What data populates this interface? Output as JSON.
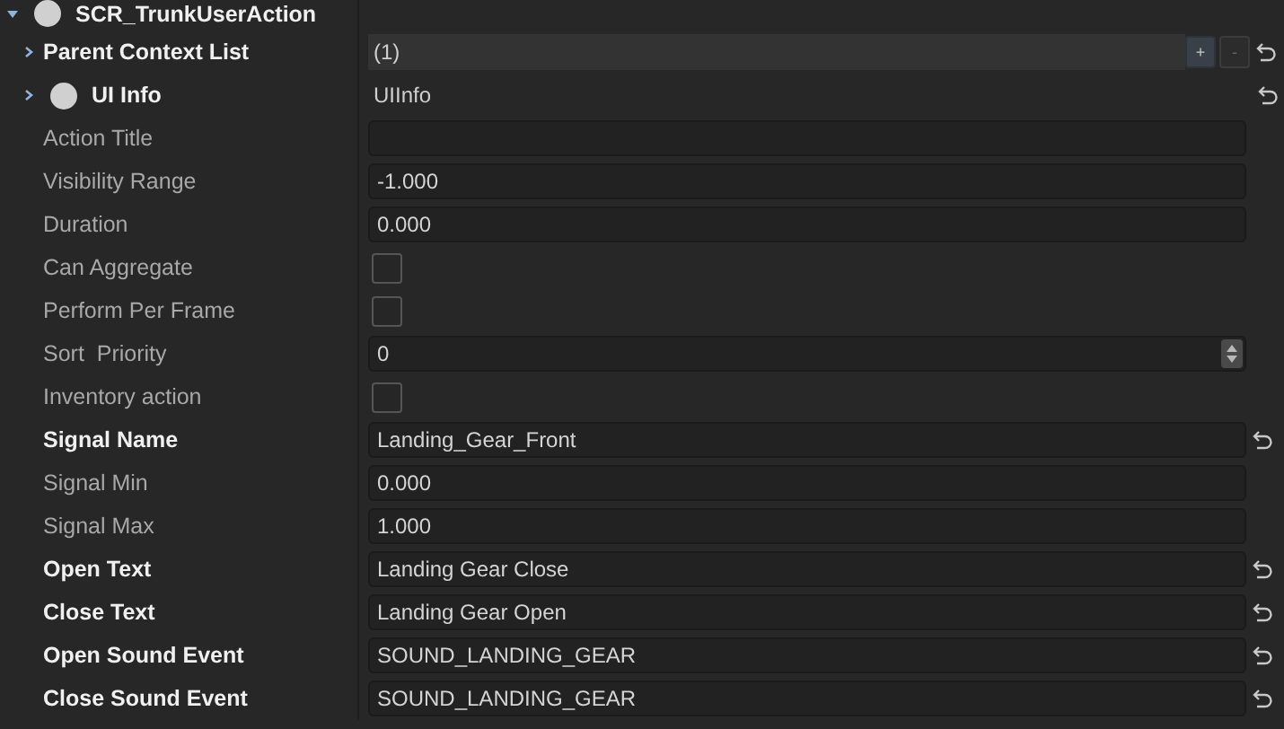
{
  "root": {
    "label": "SCR_TrunkUserAction",
    "expanded": true,
    "children": [
      {
        "kind": "list",
        "label": "Parent Context List",
        "expanded": false,
        "value": "(1)",
        "add": "+",
        "remove": "-",
        "modified": true
      },
      {
        "kind": "object",
        "label": "UI Info",
        "expanded": false,
        "value": "UIInfo",
        "modified": true
      },
      {
        "kind": "text",
        "label": "Action Title",
        "modified": false
      },
      {
        "kind": "text",
        "label": "Visibility Range",
        "value": "-1.000",
        "modified": false
      },
      {
        "kind": "text",
        "label": "Duration",
        "value": "0.000",
        "modified": false
      },
      {
        "kind": "checkbox",
        "label": "Can Aggregate",
        "checked": false,
        "modified": false
      },
      {
        "kind": "checkbox",
        "label": "Perform Per Frame",
        "checked": false,
        "modified": false
      },
      {
        "kind": "spin",
        "label": "Sort  Priority",
        "value": "0",
        "modified": false
      },
      {
        "kind": "checkbox",
        "label": "Inventory action",
        "checked": false,
        "modified": false
      },
      {
        "kind": "text",
        "label": "Signal Name",
        "value": "Landing_Gear_Front",
        "modified": true
      },
      {
        "kind": "text",
        "label": "Signal Min",
        "value": "0.000",
        "modified": false
      },
      {
        "kind": "text",
        "label": "Signal Max",
        "value": "1.000",
        "modified": false
      },
      {
        "kind": "text",
        "label": "Open Text",
        "value": "Landing Gear Close",
        "modified": true
      },
      {
        "kind": "text",
        "label": "Close Text",
        "value": "Landing Gear Open",
        "modified": true
      },
      {
        "kind": "text",
        "label": "Open Sound Event",
        "value": "SOUND_LANDING_GEAR",
        "modified": true
      },
      {
        "kind": "text",
        "label": "Close Sound Event",
        "value": "SOUND_LANDING_GEAR",
        "modified": true
      }
    ]
  }
}
